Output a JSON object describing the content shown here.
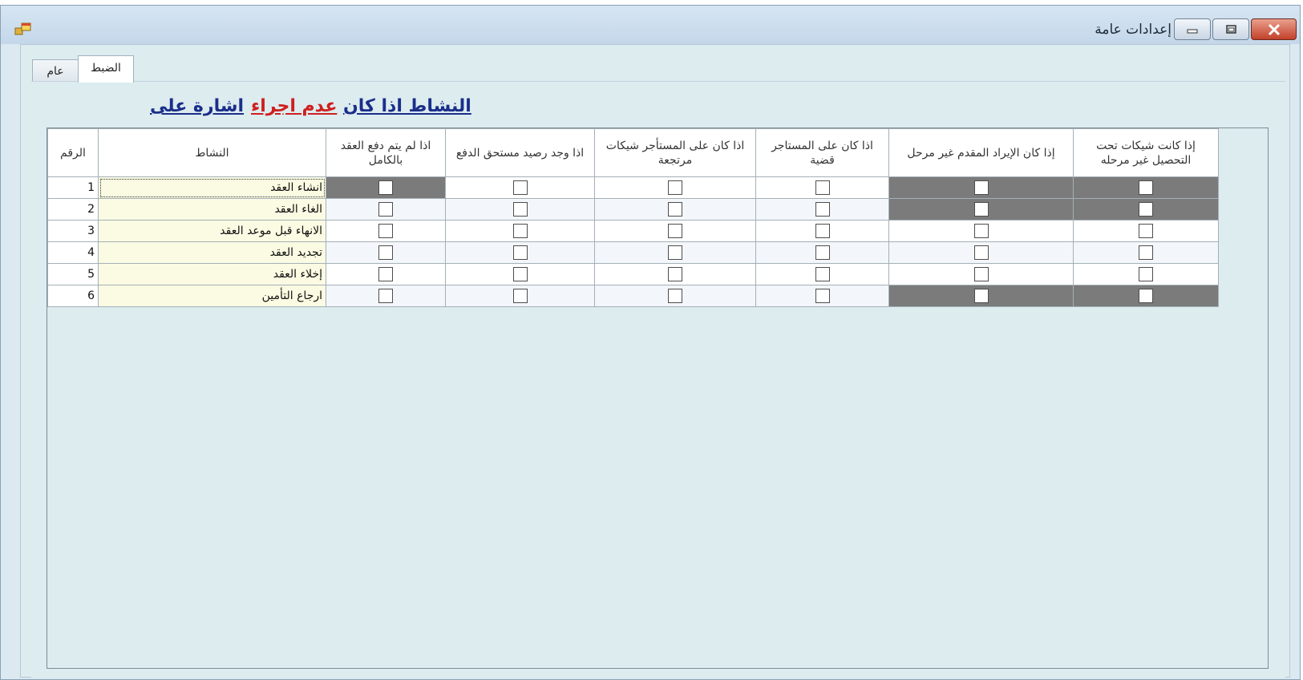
{
  "window": {
    "title": "إعدادات عامة",
    "icons": {
      "app": "app-window-icon",
      "minimize": "minimize-icon",
      "maximize": "restore-icon",
      "close": "close-icon"
    }
  },
  "tabs": [
    {
      "label": "عام",
      "active": false
    },
    {
      "label": "الضبط",
      "active": true
    }
  ],
  "headline": {
    "part1": "النشاط اذا كان",
    "part2": "عدم اجراء",
    "part3": "اشارة على",
    "colors": {
      "blue": "#1b2e8a",
      "red": "#cf1f1f"
    }
  },
  "grid": {
    "headers": {
      "number": "الرقم",
      "activity": "النشاط",
      "col1": "اذا لم يتم دفع العقد بالكامل",
      "col2": "اذا وجد رصيد مستحق الدفع",
      "col3": "اذا كان على المستأجر شيكات مرتجعة",
      "col4": "اذا كان على المستاجر قضية",
      "col5": "إذا كان الإيراد المقدم غير مرحل",
      "col6": "إذا كانت شيكات تحت التحصيل غير مرحله"
    },
    "rows": [
      {
        "number": "1",
        "activity": "انشاء العقد",
        "checks": [
          false,
          false,
          false,
          false,
          false,
          false
        ],
        "disabled": [
          true,
          false,
          false,
          false,
          true,
          true
        ]
      },
      {
        "number": "2",
        "activity": "الغاء العقد",
        "checks": [
          false,
          false,
          false,
          false,
          false,
          false
        ],
        "disabled": [
          false,
          false,
          false,
          false,
          true,
          true
        ]
      },
      {
        "number": "3",
        "activity": "الانهاء قبل موعد العقد",
        "checks": [
          false,
          false,
          false,
          false,
          false,
          false
        ],
        "disabled": [
          false,
          false,
          false,
          false,
          false,
          false
        ]
      },
      {
        "number": "4",
        "activity": "تجديد العقد",
        "checks": [
          false,
          false,
          false,
          false,
          false,
          false
        ],
        "disabled": [
          false,
          false,
          false,
          false,
          false,
          false
        ]
      },
      {
        "number": "5",
        "activity": "إخلاء العقد",
        "checks": [
          false,
          false,
          false,
          false,
          false,
          false
        ],
        "disabled": [
          false,
          false,
          false,
          false,
          false,
          false
        ]
      },
      {
        "number": "6",
        "activity": "ارجاع التأمين",
        "checks": [
          false,
          false,
          false,
          false,
          false,
          false
        ],
        "disabled": [
          false,
          false,
          false,
          false,
          true,
          true
        ]
      }
    ]
  }
}
